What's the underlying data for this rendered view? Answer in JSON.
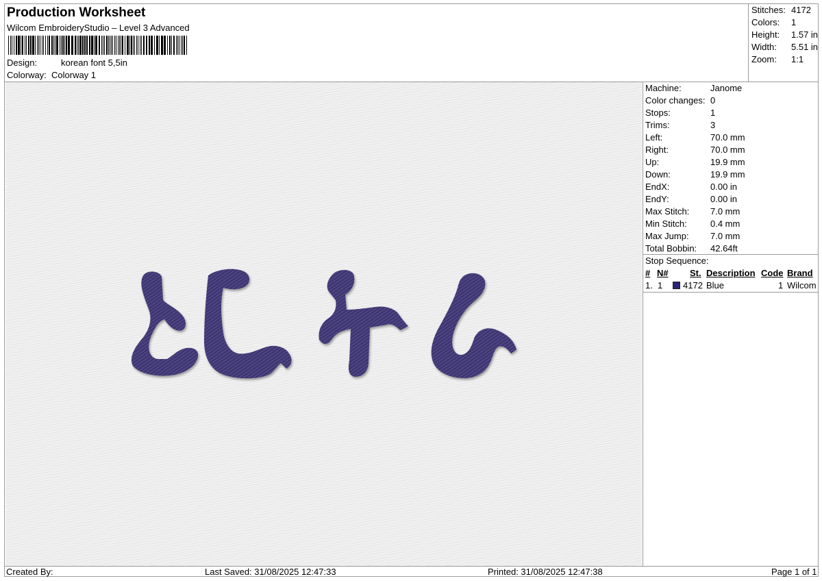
{
  "header": {
    "title": "Production Worksheet",
    "subtitle": "Wilcom EmbroideryStudio – Level 3 Advanced",
    "design_label": "Design:",
    "design_value": "korean font 5,5in",
    "colorway_label": "Colorway:",
    "colorway_value": "Colorway 1"
  },
  "summary": {
    "stitches_label": "Stitches:",
    "stitches_value": "4172",
    "colors_label": "Colors:",
    "colors_value": "1",
    "height_label": "Height:",
    "height_value": "1.57 in",
    "width_label": "Width:",
    "width_value": "5.51 in",
    "zoom_label": "Zoom:",
    "zoom_value": "1:1"
  },
  "machine_info": [
    {
      "label": "Machine:",
      "value": "Janome"
    },
    {
      "label": "Color changes:",
      "value": "0"
    },
    {
      "label": "Stops:",
      "value": "1"
    },
    {
      "label": "Trims:",
      "value": "3"
    },
    {
      "label": "Left:",
      "value": "70.0 mm"
    },
    {
      "label": "Right:",
      "value": "70.0 mm"
    },
    {
      "label": "Up:",
      "value": "19.9 mm"
    },
    {
      "label": "Down:",
      "value": "19.9 mm"
    },
    {
      "label": "EndX:",
      "value": "0.00 in"
    },
    {
      "label": "EndY:",
      "value": "0.00 in"
    },
    {
      "label": "Max Stitch:",
      "value": "7.0 mm"
    },
    {
      "label": "Min Stitch:",
      "value": "0.4 mm"
    },
    {
      "label": "Max Jump:",
      "value": "7.0 mm"
    },
    {
      "label": "Total Bobbin:",
      "value": "42.64ft"
    }
  ],
  "stop_sequence": {
    "title": "Stop Sequence:",
    "columns": {
      "num": "#",
      "n": "N#",
      "st": "St.",
      "description": "Description",
      "code": "Code",
      "brand": "Brand"
    },
    "rows": [
      {
        "num": "1.",
        "n": "1",
        "color": "#2a2472",
        "st": "4172",
        "description": "Blue",
        "code": "1",
        "brand": "Wilcom"
      }
    ]
  },
  "preview": {
    "thread_color": "#3d3570",
    "thread_shadow": "#2a2455",
    "design_text": "ኤርትራ"
  },
  "footer": {
    "created_by": "Created By:",
    "last_saved": "Last Saved: 31/08/2025 12:47:33",
    "printed": "Printed: 31/08/2025 12:47:38",
    "page": "Page 1 of 1"
  }
}
